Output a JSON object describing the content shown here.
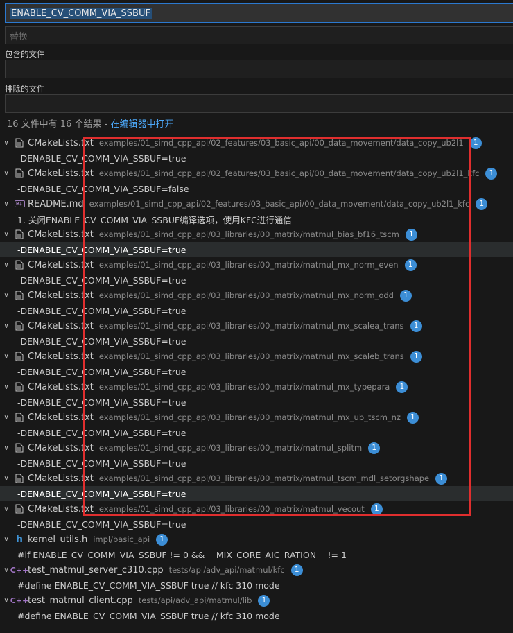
{
  "search": {
    "value": "ENABLE_CV_COMM_VIA_SSBUF"
  },
  "replace": {
    "placeholder": "替换"
  },
  "include": {
    "label": "包含的文件"
  },
  "exclude": {
    "label": "排除的文件"
  },
  "summary": {
    "text": "16 文件中有 16 个结果 - ",
    "link": "在编辑器中打开"
  },
  "results": [
    {
      "file": "CMakeLists.txt",
      "icon": "file-icon",
      "path": "examples/01_simd_cpp_api/02_features/03_basic_api/00_data_movement/data_copy_ub2l1",
      "count": "1",
      "match": "-DENABLE_CV_COMM_VIA_SSBUF=true"
    },
    {
      "file": "CMakeLists.txt",
      "icon": "file-icon",
      "path": "examples/01_simd_cpp_api/02_features/03_basic_api/00_data_movement/data_copy_ub2l1_kfc",
      "count": "1",
      "match": "-DENABLE_CV_COMM_VIA_SSBUF=false"
    },
    {
      "file": "README.md",
      "icon": "markdown-icon",
      "path": "examples/01_simd_cpp_api/02_features/03_basic_api/00_data_movement/data_copy_ub2l1_kfc",
      "count": "1",
      "match": "1. 关闭ENABLE_CV_COMM_VIA_SSBUF编译选项，使用KFC进行通信"
    },
    {
      "file": "CMakeLists.txt",
      "icon": "file-icon",
      "path": "examples/01_simd_cpp_api/03_libraries/00_matrix/matmul_bias_bf16_tscm",
      "count": "1",
      "match": "-DENABLE_CV_COMM_VIA_SSBUF=true"
    },
    {
      "file": "CMakeLists.txt",
      "icon": "file-icon",
      "path": "examples/01_simd_cpp_api/03_libraries/00_matrix/matmul_mx_norm_even",
      "count": "1",
      "match": "-DENABLE_CV_COMM_VIA_SSBUF=true"
    },
    {
      "file": "CMakeLists.txt",
      "icon": "file-icon",
      "path": "examples/01_simd_cpp_api/03_libraries/00_matrix/matmul_mx_norm_odd",
      "count": "1",
      "match": "-DENABLE_CV_COMM_VIA_SSBUF=true"
    },
    {
      "file": "CMakeLists.txt",
      "icon": "file-icon",
      "path": "examples/01_simd_cpp_api/03_libraries/00_matrix/matmul_mx_scalea_trans",
      "count": "1",
      "match": "-DENABLE_CV_COMM_VIA_SSBUF=true"
    },
    {
      "file": "CMakeLists.txt",
      "icon": "file-icon",
      "path": "examples/01_simd_cpp_api/03_libraries/00_matrix/matmul_mx_scaleb_trans",
      "count": "1",
      "match": "-DENABLE_CV_COMM_VIA_SSBUF=true"
    },
    {
      "file": "CMakeLists.txt",
      "icon": "file-icon",
      "path": "examples/01_simd_cpp_api/03_libraries/00_matrix/matmul_mx_typepara",
      "count": "1",
      "match": "-DENABLE_CV_COMM_VIA_SSBUF=true"
    },
    {
      "file": "CMakeLists.txt",
      "icon": "file-icon",
      "path": "examples/01_simd_cpp_api/03_libraries/00_matrix/matmul_mx_ub_tscm_nz",
      "count": "1",
      "match": "-DENABLE_CV_COMM_VIA_SSBUF=true"
    },
    {
      "file": "CMakeLists.txt",
      "icon": "file-icon",
      "path": "examples/01_simd_cpp_api/03_libraries/00_matrix/matmul_splitm",
      "count": "1",
      "match": "-DENABLE_CV_COMM_VIA_SSBUF=true"
    },
    {
      "file": "CMakeLists.txt",
      "icon": "file-icon",
      "path": "examples/01_simd_cpp_api/03_libraries/00_matrix/matmul_tscm_mdl_setorgshape",
      "count": "1",
      "match": "-DENABLE_CV_COMM_VIA_SSBUF=true"
    },
    {
      "file": "CMakeLists.txt",
      "icon": "file-icon",
      "path": "examples/01_simd_cpp_api/03_libraries/00_matrix/matmul_vecout",
      "count": "1",
      "match": "-DENABLE_CV_COMM_VIA_SSBUF=true"
    },
    {
      "file": "kernel_utils.h",
      "icon": "c-header-icon",
      "path": "impl/basic_api",
      "count": "1",
      "match": "#if ENABLE_CV_COMM_VIA_SSBUF != 0 && __MIX_CORE_AIC_RATION__ != 1"
    },
    {
      "file": "test_matmul_server_c310.cpp",
      "icon": "cpp-icon",
      "path": "tests/api/adv_api/matmul/kfc",
      "count": "1",
      "match": "#define ENABLE_CV_COMM_VIA_SSBUF true // kfc 310 mode"
    },
    {
      "file": "test_matmul_client.cpp",
      "icon": "cpp-icon",
      "path": "tests/api/adv_api/matmul/lib",
      "count": "1",
      "match": "#define ENABLE_CV_COMM_VIA_SSBUF true // kfc 310 mode"
    }
  ],
  "selected_rows": [
    3,
    11
  ],
  "colors": {
    "accent": "#3c8ed6",
    "highlight_box": "#e02e2e",
    "link": "#4daafc"
  }
}
